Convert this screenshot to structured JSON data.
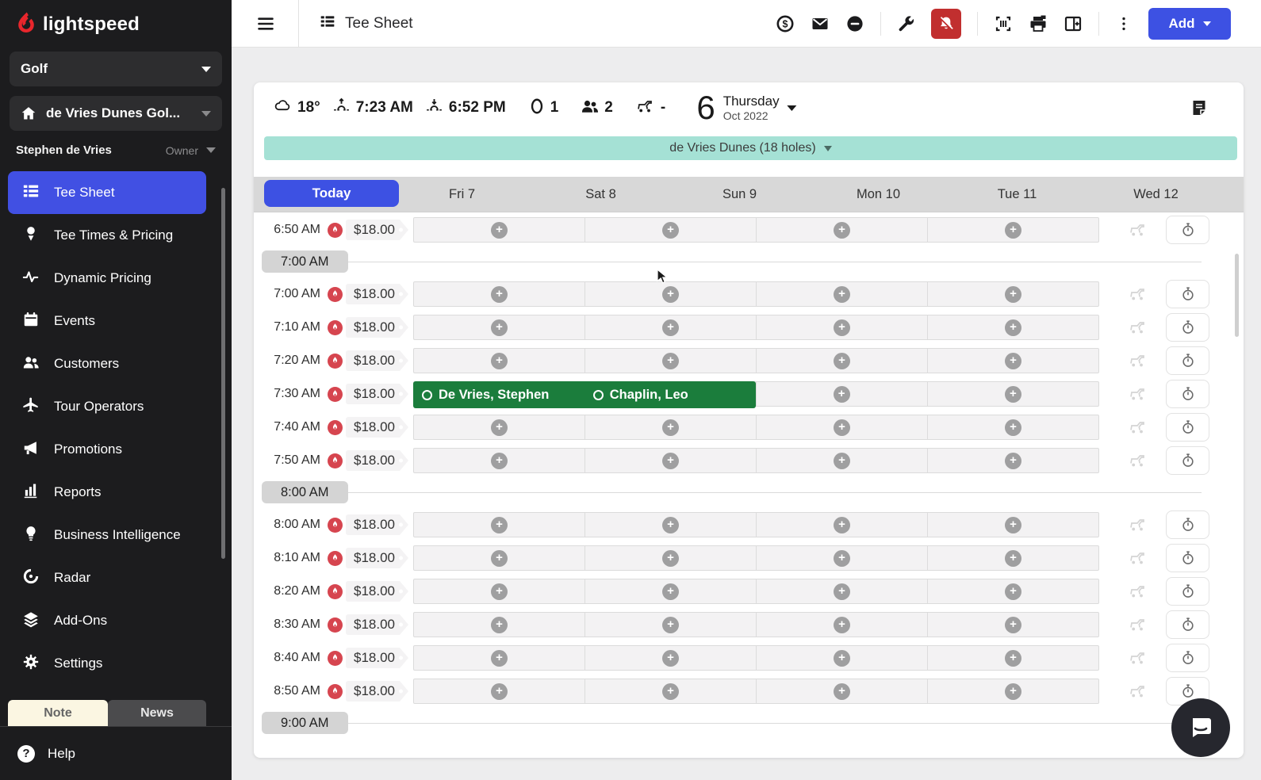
{
  "colors": {
    "accent_blue": "#3d51e3",
    "brand_red": "#e8262c",
    "alert_red": "#c12f2f",
    "teal_bar": "#a5e1d5",
    "booking_green": "#1b7d3c",
    "flame_red": "#d6454f"
  },
  "brand": {
    "name": "lightspeed"
  },
  "sidebar": {
    "workspace": {
      "label": "Golf"
    },
    "venue": {
      "label": "de Vries Dunes Gol..."
    },
    "user": {
      "name": "Stephen de Vries",
      "role": "Owner"
    },
    "items": [
      {
        "icon": "tee-sheet",
        "label": "Tee Sheet",
        "active": true
      },
      {
        "icon": "tee-times",
        "label": "Tee Times & Pricing",
        "active": false
      },
      {
        "icon": "dynamic-pricing",
        "label": "Dynamic Pricing",
        "active": false
      },
      {
        "icon": "events",
        "label": "Events",
        "active": false
      },
      {
        "icon": "customers",
        "label": "Customers",
        "active": false
      },
      {
        "icon": "tour-operators",
        "label": "Tour Operators",
        "active": false
      },
      {
        "icon": "promotions",
        "label": "Promotions",
        "active": false
      },
      {
        "icon": "reports",
        "label": "Reports",
        "active": false
      },
      {
        "icon": "business-intelligence",
        "label": "Business Intelligence",
        "active": false
      },
      {
        "icon": "radar",
        "label": "Radar",
        "active": false
      },
      {
        "icon": "add-ons",
        "label": "Add-Ons",
        "active": false
      },
      {
        "icon": "settings",
        "label": "Settings",
        "active": false
      }
    ],
    "bottom_tabs": {
      "note": "Note",
      "news": "News"
    },
    "help": "Help"
  },
  "topbar": {
    "title": "Tee Sheet",
    "add_button": "Add"
  },
  "infobar": {
    "temperature": "18°",
    "sunrise": "7:23 AM",
    "sunset": "6:52 PM",
    "rounds": "1",
    "players": "2",
    "carts": "-",
    "date": {
      "day": "6",
      "weekday": "Thursday",
      "month_year": "Oct 2022"
    }
  },
  "course_selector": {
    "label": "de Vries Dunes (18 holes)"
  },
  "day_tabs": [
    {
      "label": "Today",
      "active": true
    },
    {
      "label": "Fri 7",
      "active": false
    },
    {
      "label": "Sat 8",
      "active": false
    },
    {
      "label": "Sun 9",
      "active": false
    },
    {
      "label": "Mon 10",
      "active": false
    },
    {
      "label": "Tue 11",
      "active": false
    },
    {
      "label": "Wed 12",
      "active": false
    }
  ],
  "sheet": {
    "slot_count": 4,
    "rows": [
      {
        "type": "tee-time",
        "time": "6:50 AM",
        "price": "$18.00"
      },
      {
        "type": "hour",
        "label": "7:00 AM"
      },
      {
        "type": "tee-time",
        "time": "7:00 AM",
        "price": "$18.00"
      },
      {
        "type": "tee-time",
        "time": "7:10 AM",
        "price": "$18.00"
      },
      {
        "type": "tee-time",
        "time": "7:20 AM",
        "price": "$18.00"
      },
      {
        "type": "tee-time",
        "time": "7:30 AM",
        "price": "$18.00",
        "booking": {
          "players": [
            "De Vries, Stephen",
            "Chaplin, Leo"
          ],
          "slots": 2
        }
      },
      {
        "type": "tee-time",
        "time": "7:40 AM",
        "price": "$18.00"
      },
      {
        "type": "tee-time",
        "time": "7:50 AM",
        "price": "$18.00"
      },
      {
        "type": "hour",
        "label": "8:00 AM"
      },
      {
        "type": "tee-time",
        "time": "8:00 AM",
        "price": "$18.00"
      },
      {
        "type": "tee-time",
        "time": "8:10 AM",
        "price": "$18.00"
      },
      {
        "type": "tee-time",
        "time": "8:20 AM",
        "price": "$18.00"
      },
      {
        "type": "tee-time",
        "time": "8:30 AM",
        "price": "$18.00"
      },
      {
        "type": "tee-time",
        "time": "8:40 AM",
        "price": "$18.00"
      },
      {
        "type": "tee-time",
        "time": "8:50 AM",
        "price": "$18.00"
      },
      {
        "type": "hour",
        "label": "9:00 AM"
      }
    ]
  }
}
